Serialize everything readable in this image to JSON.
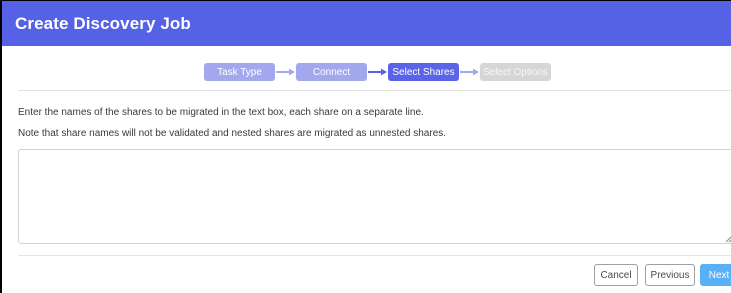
{
  "dialog": {
    "title": "Create Discovery Job"
  },
  "wizard": {
    "steps": [
      {
        "label": "Task Type",
        "state": "done"
      },
      {
        "label": "Connect",
        "state": "done"
      },
      {
        "label": "Select Shares",
        "state": "current"
      },
      {
        "label": "Select Options",
        "state": "pending"
      }
    ]
  },
  "content": {
    "instruction_1": "Enter the names of the shares to be migrated in the text box, each share on a separate line.",
    "instruction_2": "Note that share names will not be validated and nested shares are migrated as unnested shares.",
    "shares_value": ""
  },
  "footer": {
    "cancel_label": "Cancel",
    "previous_label": "Previous",
    "next_label": "Next"
  },
  "colors": {
    "header_bg": "#5562e6",
    "step_done": "#a3a8ee",
    "step_current": "#5a64e8",
    "step_pending": "#d6d6d6",
    "next_button": "#5ab0f5"
  },
  "icons": {
    "step_arrow": "arrow-right-icon",
    "resize": "resize-grip-icon"
  }
}
